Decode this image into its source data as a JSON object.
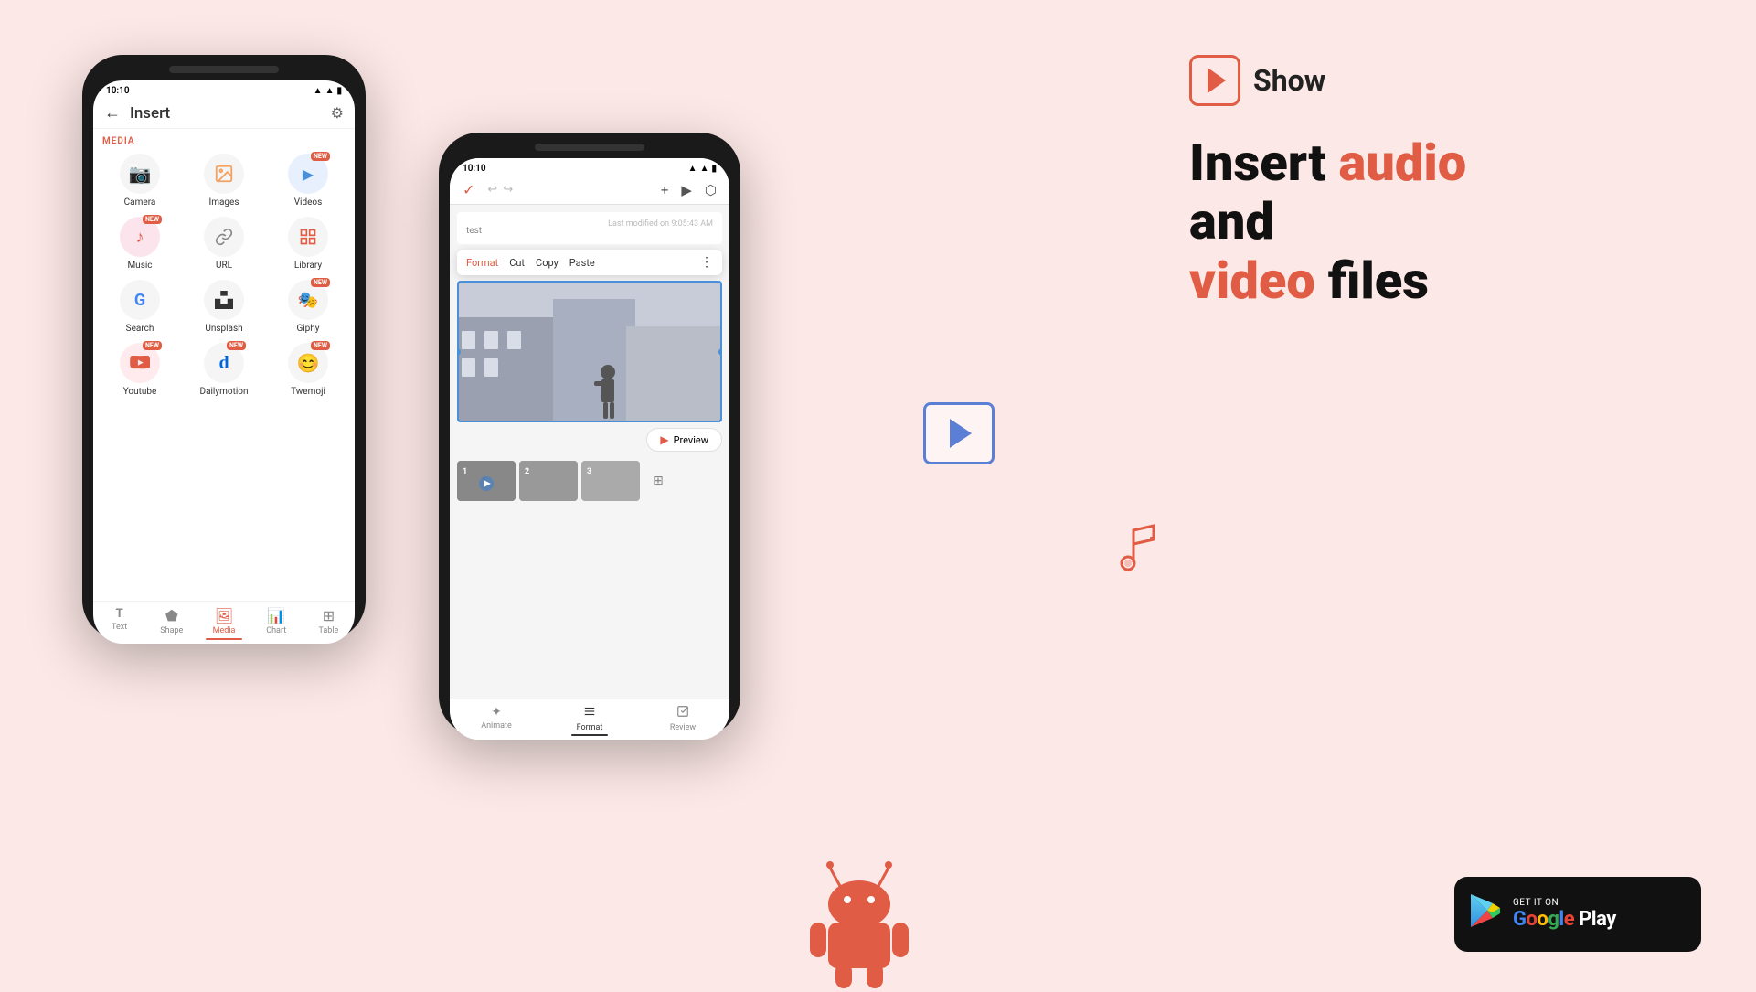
{
  "background_color": "#fce8e6",
  "left_phone": {
    "status_time": "10:10",
    "header_title": "Insert",
    "section_media": "MEDIA",
    "settings_icon": "⚙",
    "icons": [
      {
        "label": "Camera",
        "emoji": "📷",
        "badge": null
      },
      {
        "label": "Images",
        "emoji": "🖼",
        "badge": null
      },
      {
        "label": "Videos",
        "emoji": "▶",
        "badge": "NEW"
      },
      {
        "label": "Music",
        "emoji": "🎵",
        "badge": "NEW"
      },
      {
        "label": "URL",
        "emoji": "🔗",
        "badge": null
      },
      {
        "label": "Library",
        "emoji": "📚",
        "badge": null
      },
      {
        "label": "Search",
        "emoji": "G",
        "badge": null
      },
      {
        "label": "Unsplash",
        "emoji": "⊞",
        "badge": null
      },
      {
        "label": "Giphy",
        "emoji": "🎭",
        "badge": "NEW"
      },
      {
        "label": "Youtube",
        "emoji": "▶",
        "badge": "NEW"
      },
      {
        "label": "Dailymotion",
        "emoji": "d",
        "badge": "NEW"
      },
      {
        "label": "Twemoji",
        "emoji": "😊",
        "badge": "NEW"
      }
    ],
    "nav_items": [
      {
        "label": "Text",
        "icon": "T",
        "active": false
      },
      {
        "label": "Shape",
        "icon": "⬟",
        "active": false
      },
      {
        "label": "Media",
        "icon": "🖼",
        "active": true
      },
      {
        "label": "Chart",
        "icon": "📊",
        "active": false
      },
      {
        "label": "Table",
        "icon": "⊞",
        "active": false
      }
    ]
  },
  "right_phone": {
    "status_time": "10:10",
    "filename": "test",
    "last_modified": "Last modified on 9:05:43 AM",
    "context_menu": [
      "Format",
      "Cut",
      "Copy",
      "Paste",
      "⋮"
    ],
    "preview_label": "Preview",
    "format_tabs": [
      "Animate",
      "Format",
      "Review"
    ]
  },
  "branding": {
    "app_logo": "▶",
    "app_name": "Show",
    "headline_part1": "Insert ",
    "headline_audio": "audio",
    "headline_part2": " and",
    "headline_video": "video",
    "headline_part3": " files"
  },
  "google_play": {
    "top_text": "GET IT ON",
    "main_text": "Google Play"
  }
}
